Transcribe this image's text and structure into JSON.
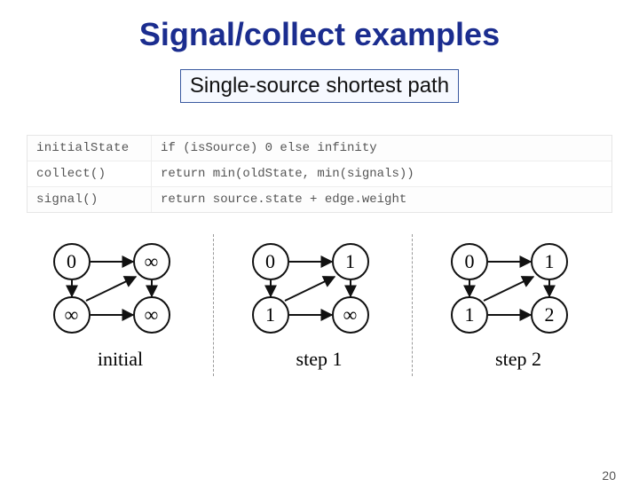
{
  "title": "Signal/collect examples",
  "subtitle": "Single-source shortest path",
  "code": {
    "row0": {
      "label": "initialState",
      "body": "if (isSource) 0 else infinity"
    },
    "row1": {
      "label": "collect()",
      "body": "return min(oldState, min(signals))"
    },
    "row2": {
      "label": "signal()",
      "body": "return source.state + edge.weight"
    }
  },
  "diagrams": {
    "initial": {
      "tl": "0",
      "tr": "∞",
      "bl": "∞",
      "br": "∞",
      "caption": "initial"
    },
    "step1": {
      "tl": "0",
      "tr": "1",
      "bl": "1",
      "br": "∞",
      "caption": "step 1"
    },
    "step2": {
      "tl": "0",
      "tr": "1",
      "bl": "1",
      "br": "2",
      "caption": "step 2"
    }
  },
  "page_number": "20"
}
